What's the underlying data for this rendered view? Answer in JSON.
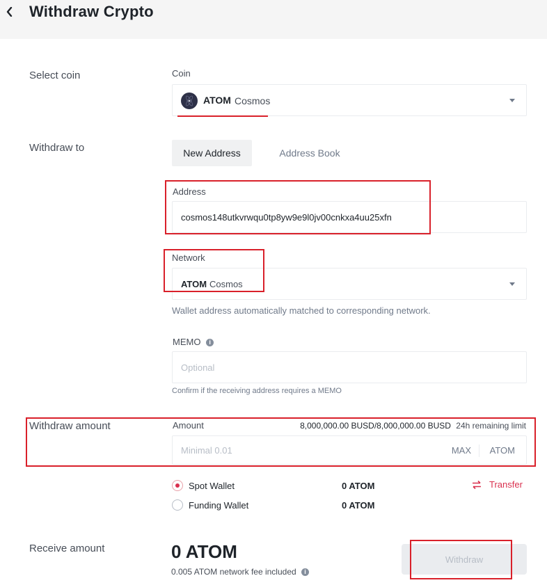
{
  "header": {
    "title": "Withdraw Crypto"
  },
  "select_coin": {
    "section_label": "Select coin",
    "field_label": "Coin",
    "symbol": "ATOM",
    "name": "Cosmos"
  },
  "withdraw_to": {
    "section_label": "Withdraw to",
    "tabs": [
      "New Address",
      "Address Book"
    ],
    "address_label": "Address",
    "address_value": "cosmos148utkvrwqu0tp8yw9e9l0jv00cnkxa4uu25xfn",
    "network_label": "Network",
    "network_symbol": "ATOM",
    "network_name": "Cosmos",
    "network_hint": "Wallet address automatically matched to corresponding network.",
    "memo_label": "MEMO",
    "memo_placeholder": "Optional",
    "memo_hint": "Confirm if the receiving address requires a MEMO"
  },
  "withdraw_amount": {
    "section_label": "Withdraw amount",
    "amount_label": "Amount",
    "limit_value": "8,000,000.00 BUSD/8,000,000.00 BUSD",
    "limit_text": "24h remaining limit",
    "amount_placeholder": "Minimal 0.01",
    "max_label": "MAX",
    "unit": "ATOM"
  },
  "wallets": [
    {
      "name": "Spot Wallet",
      "balance": "0 ATOM",
      "selected": true
    },
    {
      "name": "Funding Wallet",
      "balance": "0 ATOM",
      "selected": false
    }
  ],
  "transfer_label": "Transfer",
  "receive": {
    "section_label": "Receive amount",
    "amount": "0 ATOM",
    "fee_text": "0.005 ATOM network fee included"
  },
  "withdraw_button_label": "Withdraw",
  "colors": {
    "accent_red": "#d9202a",
    "radio_red": "#d9304e",
    "text_primary": "#1e2329",
    "text_secondary": "#707a8a"
  },
  "icons": {
    "back": "chevron-left-icon",
    "coin": "atom-coin-icon",
    "dropdown": "caret-down-icon",
    "info": "info-icon",
    "transfer": "swap-arrows-icon"
  }
}
